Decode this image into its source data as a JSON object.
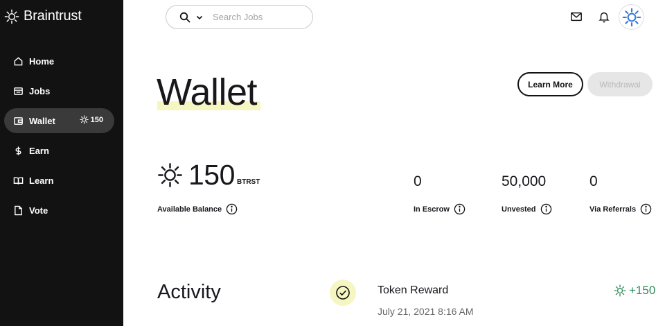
{
  "brand": {
    "name": "Braintrust",
    "icon": "sun-logo-icon"
  },
  "sidebar": {
    "items": [
      {
        "label": "Home",
        "icon": "home-icon"
      },
      {
        "label": "Jobs",
        "icon": "jobs-icon"
      },
      {
        "label": "Wallet",
        "icon": "wallet-icon",
        "badge": "150",
        "active": true
      },
      {
        "label": "Earn",
        "icon": "dollar-icon"
      },
      {
        "label": "Learn",
        "icon": "book-icon"
      },
      {
        "label": "Vote",
        "icon": "document-icon"
      }
    ]
  },
  "header": {
    "search_placeholder": "Search Jobs",
    "icons": [
      "search-icon",
      "chevron-down-icon",
      "mail-icon",
      "bell-icon",
      "avatar"
    ]
  },
  "page": {
    "title": "Wallet",
    "learn_more_label": "Learn More",
    "withdrawal_label": "Withdrawal"
  },
  "balance": {
    "available_value": "150",
    "unit": "BTRST",
    "available_label": "Available Balance",
    "stats": [
      {
        "value": "0",
        "label": "In Escrow"
      },
      {
        "value": "50,000",
        "label": "Unvested"
      },
      {
        "value": "0",
        "label": "Via Referrals"
      }
    ]
  },
  "activity": {
    "title": "Activity",
    "items": [
      {
        "name": "Token Reward",
        "date": "July 21, 2021 8:16 AM",
        "amount": "+150"
      }
    ]
  },
  "colors": {
    "sidebar_bg": "#121212",
    "active_item_bg": "#3a3a3a",
    "highlight_yellow": "#f5f6c2",
    "positive_green": "#2f8a59",
    "avatar_blue": "#3a78d8"
  }
}
